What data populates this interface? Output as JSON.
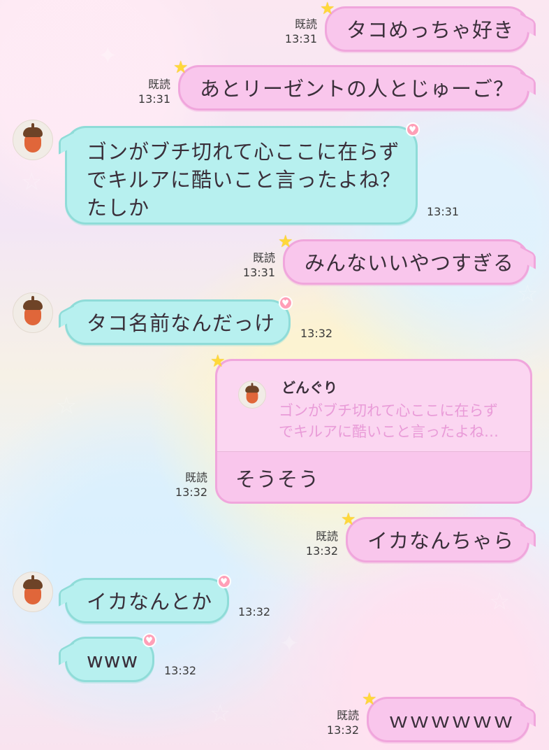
{
  "read_label": "既読",
  "icons": {
    "read_badge": "star-icon",
    "heart_badge": "heart-icon",
    "avatar": "acorn-icon"
  },
  "colors": {
    "my_bubble": "#f9c6ec",
    "my_border": "#f0a6dc",
    "other_bubble": "#b7f0ef",
    "other_border": "#8fdcd8",
    "star": "#ffd83a"
  },
  "messages": [
    {
      "side": "me",
      "text": "タコめっちゃ好き",
      "time": "13:31",
      "read": "既読"
    },
    {
      "side": "me",
      "text": "あとリーゼントの人とじゅーご？",
      "time": "13:31",
      "read": "既読"
    },
    {
      "side": "other",
      "lines": [
        "ゴンがブチ切れて心ここに在らず",
        "でキルアに酷いこと言ったよね？",
        "たしか"
      ],
      "time": "13:31"
    },
    {
      "side": "me",
      "text": "みんないいやつすぎる",
      "time": "13:31",
      "read": "既読"
    },
    {
      "side": "other",
      "text": "タコ名前なんだっけ",
      "time": "13:32"
    },
    {
      "side": "me",
      "type": "reply",
      "reply_name": "どんぐり",
      "reply_lines": [
        "ゴンがブチ切れて心ここに在らず",
        "でキルアに酷いこと言ったよね…"
      ],
      "text": "そうそう",
      "time": "13:32",
      "read": "既読"
    },
    {
      "side": "me",
      "text": "イカなんちゃら",
      "time": "13:32",
      "read": "既読"
    },
    {
      "side": "other",
      "text": "イカなんとか",
      "time": "13:32"
    },
    {
      "side": "other",
      "text": "www",
      "time": "13:32"
    },
    {
      "side": "me",
      "text": "ｗｗｗｗｗｗ",
      "time": "13:32",
      "read": "既読"
    }
  ]
}
